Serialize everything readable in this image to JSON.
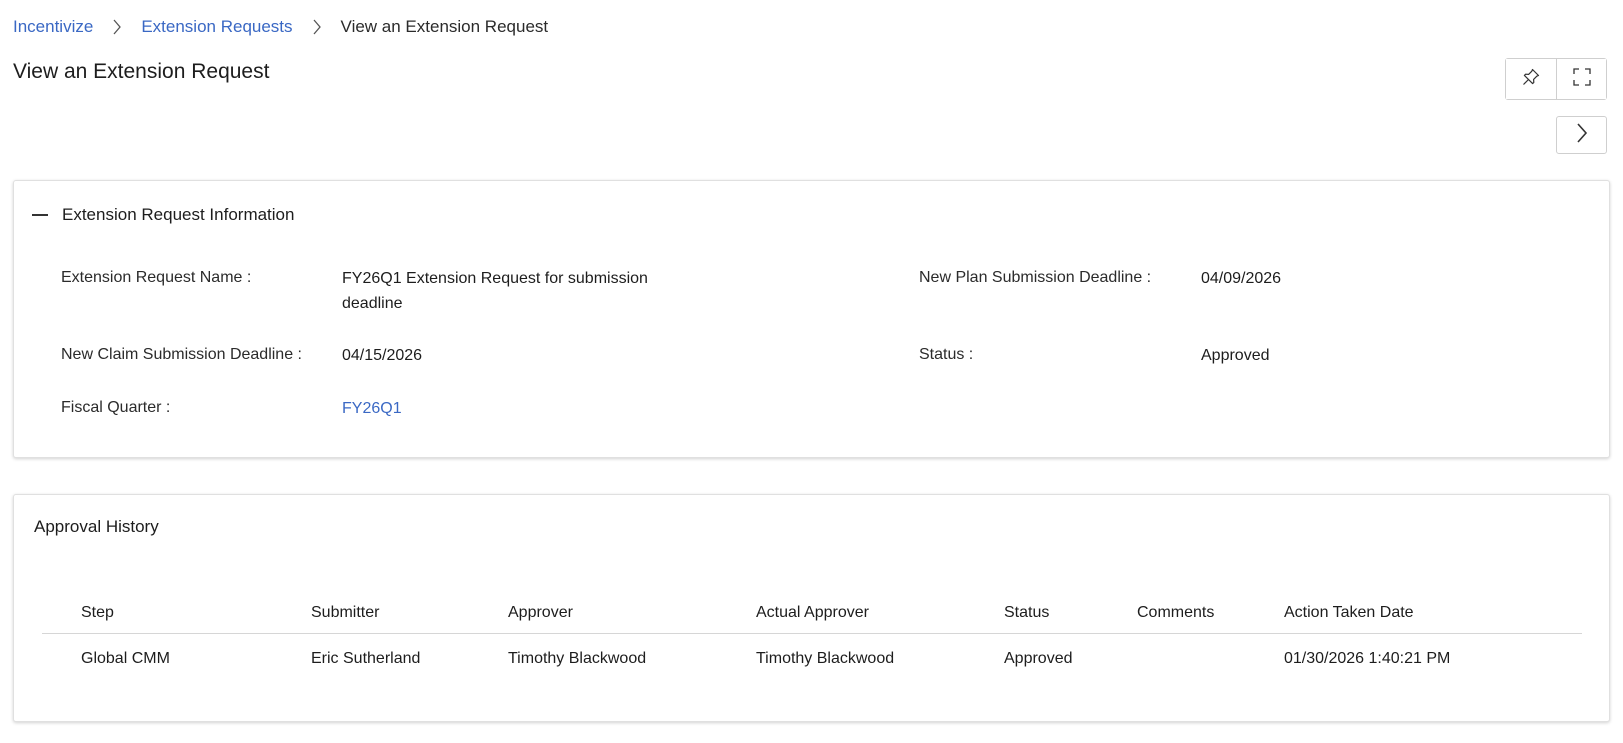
{
  "breadcrumb": {
    "items": [
      "Incentivize",
      "Extension Requests"
    ],
    "current": "View an Extension Request"
  },
  "page": {
    "title": "View an Extension Request"
  },
  "toolbar": {
    "pin_icon": "pin-icon",
    "fullscreen_icon": "fullscreen-icon",
    "next_icon": "chevron-right-icon"
  },
  "info_section": {
    "title": "Extension Request Information",
    "fields": {
      "name": {
        "label": "Extension Request Name :",
        "value_line1": "FY26Q1 Extension Request for submission",
        "value_line2": "deadline"
      },
      "plan_deadline": {
        "label": "New Plan Submission Deadline :",
        "value": "04/09/2026"
      },
      "claim_deadline": {
        "label": "New Claim Submission Deadline :",
        "value": "04/15/2026"
      },
      "status": {
        "label": "Status :",
        "value": "Approved"
      },
      "fiscal_quarter": {
        "label": "Fiscal Quarter :",
        "value": "FY26Q1"
      }
    }
  },
  "approval_history": {
    "title": "Approval History",
    "columns": [
      "Step",
      "Submitter",
      "Approver",
      "Actual Approver",
      "Status",
      "Comments",
      "Action Taken Date"
    ],
    "rows": [
      [
        "Global CMM",
        "Eric Sutherland",
        "Timothy Blackwood",
        "Timothy Blackwood",
        "Approved",
        "",
        "01/30/2026 1:40:21 PM"
      ]
    ]
  },
  "colors": {
    "link": "#3a68c4",
    "border": "#cfcfcf",
    "text": "#1d1d1d"
  }
}
